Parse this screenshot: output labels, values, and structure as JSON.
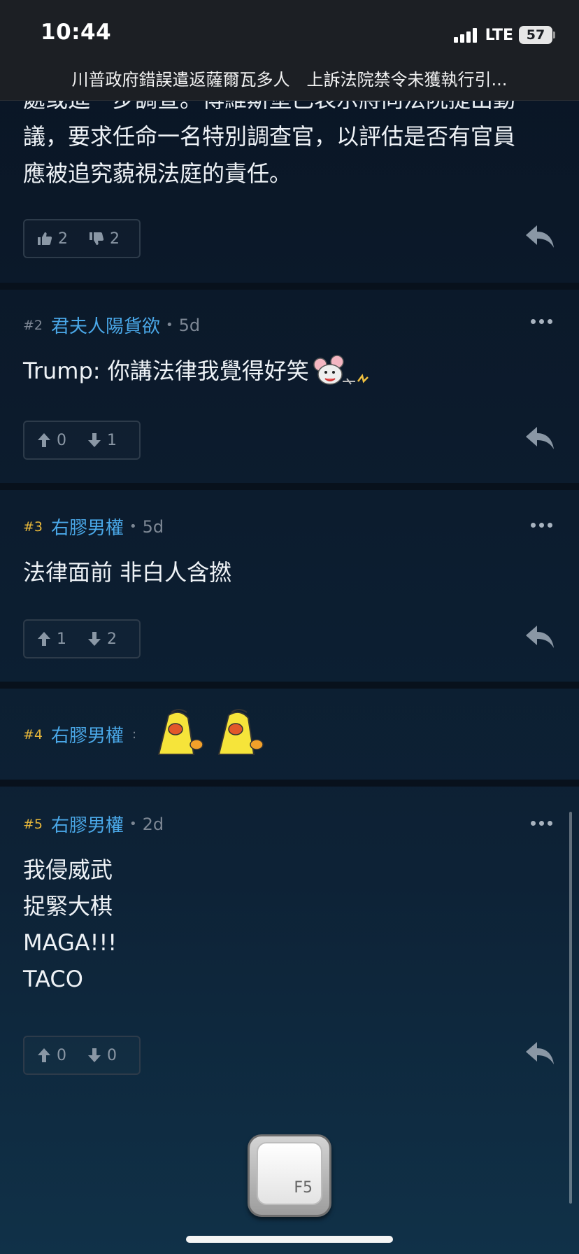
{
  "status_bar": {
    "time": "10:44",
    "network": "LTE",
    "battery": "57"
  },
  "header": {
    "title": "川普政府錯誤遣返薩爾瓦多人　上訴法院禁令未獲執行引..."
  },
  "posts": [
    {
      "body_lines_partial": "處或進一步調查。博維斯堡已表示將向法院提出動",
      "body_lines": [
        "議，要求任命一名特別調查官，以評估是否有官員",
        "應被追究藐視法庭的責任。"
      ],
      "votes": {
        "up": "2",
        "down": "2"
      }
    },
    {
      "floor": "#2",
      "user": "君夫人陽貨欲",
      "age": "5d",
      "body": "Trump: 你講法律我覺得好笑",
      "votes": {
        "up": "0",
        "down": "1"
      }
    },
    {
      "floor": "#3",
      "user": "右膠男權",
      "age": "5d",
      "body": "法律面前 非白人含撚",
      "votes": {
        "up": "1",
        "down": "2"
      }
    },
    {
      "floor": "#4",
      "user": "右膠男權",
      "separator": ":"
    },
    {
      "floor": "#5",
      "user": "右膠男權",
      "age": "2d",
      "body_lines": [
        "我侵威武",
        "捉緊大棋",
        "MAGA!!!",
        "TACO"
      ],
      "votes": {
        "up": "0",
        "down": "0"
      }
    }
  ],
  "refresh_key": {
    "label": "F5"
  },
  "colors": {
    "username": "#4aa8e8",
    "floor_highlight": "#e7b73a",
    "background": "#0b1a2a"
  }
}
